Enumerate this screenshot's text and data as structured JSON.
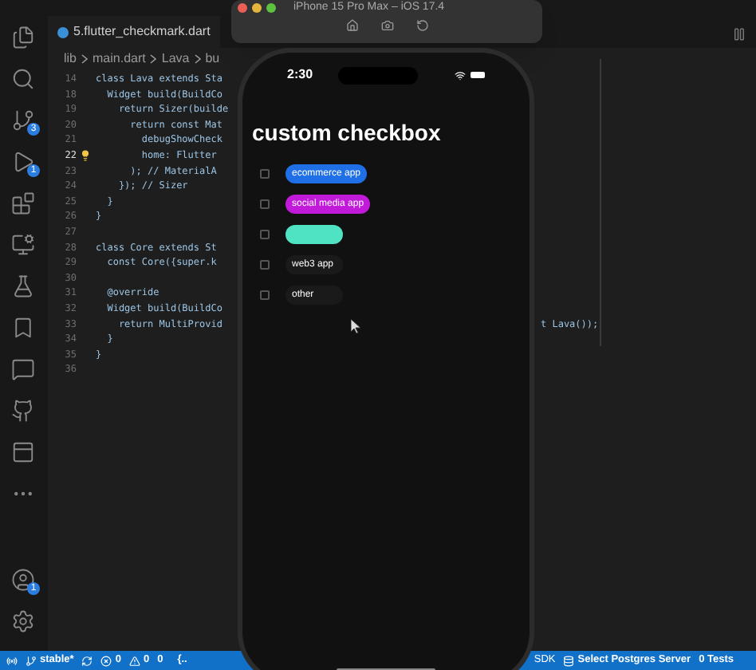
{
  "activity_bar": {
    "items": [
      {
        "kind": "files"
      },
      {
        "kind": "search"
      },
      {
        "kind": "branch",
        "badge": "3"
      },
      {
        "kind": "run",
        "badge": "1"
      },
      {
        "kind": "extensions"
      },
      {
        "kind": "remote"
      },
      {
        "kind": "flask"
      },
      {
        "kind": "bookmark"
      },
      {
        "kind": "chat"
      },
      {
        "kind": "github"
      },
      {
        "kind": "panel"
      },
      {
        "kind": "more"
      }
    ],
    "bottom_items": [
      {
        "kind": "account",
        "badge": "1"
      },
      {
        "kind": "settings"
      }
    ]
  },
  "editor": {
    "tab": "5.flutter_checkmark.dart",
    "breadcrumb": [
      "lib",
      "main.dart",
      "Lava",
      "bu"
    ],
    "code_lines": [
      {
        "number": "14",
        "text": "class Lava extends Sta",
        "current": false
      },
      {
        "number": "18",
        "text": "  Widget build(BuildCo",
        "current": false
      },
      {
        "number": "19",
        "text": "    return Sizer(builde",
        "current": false
      },
      {
        "number": "20",
        "text": "      return const Mat",
        "current": false
      },
      {
        "number": "21",
        "text": "        debugShowCheck",
        "current": false
      },
      {
        "number": "22",
        "text": "        home: Flutter",
        "current": true
      },
      {
        "number": "23",
        "text": "      ); // MaterialA",
        "current": false
      },
      {
        "number": "24",
        "text": "    }); // Sizer",
        "current": false
      },
      {
        "number": "25",
        "text": "  }",
        "current": false
      },
      {
        "number": "26",
        "text": "}",
        "current": false
      },
      {
        "number": "27",
        "current": false
      },
      {
        "number": "28",
        "text": "class Core extends St",
        "current": false
      },
      {
        "number": "29",
        "text": "  const Core({super.k",
        "current": false
      },
      {
        "number": "30",
        "current": false
      },
      {
        "number": "31",
        "text": "  @override",
        "current": false
      },
      {
        "number": "32",
        "text": "  Widget build(BuildCo",
        "current": false
      },
      {
        "number": "33",
        "text": "    return MultiProvid",
        "current": false,
        "tail": "t Lava());"
      },
      {
        "number": "34",
        "text": "  }",
        "current": false
      },
      {
        "number": "35",
        "text": "}",
        "current": false
      },
      {
        "number": "36",
        "current": false
      }
    ]
  },
  "simulator": {
    "title": "iPhone 15 Pro Max – iOS 17.4",
    "time": "2:30",
    "app_title": "custom checkbox",
    "options": [
      {
        "label": "ecommerce app",
        "color": "#1f6fe6",
        "checked": false
      },
      {
        "label": "social media app",
        "color": "#c11ad9",
        "checked": false
      },
      {
        "color": "#4fe3c4",
        "checked": false
      },
      {
        "label": "web3 app",
        "color": "#1a1a1a",
        "checked": false
      },
      {
        "label": "other",
        "color": "#1a1a1a",
        "checked": false
      }
    ]
  },
  "status_bar": {
    "branch": "stable*",
    "errors": "0",
    "warnings": "0",
    "ports": "0",
    "left_tail": "{..",
    "sdk": "SDK",
    "postgres": "Select Postgres Server",
    "tests": "0 Tests"
  }
}
